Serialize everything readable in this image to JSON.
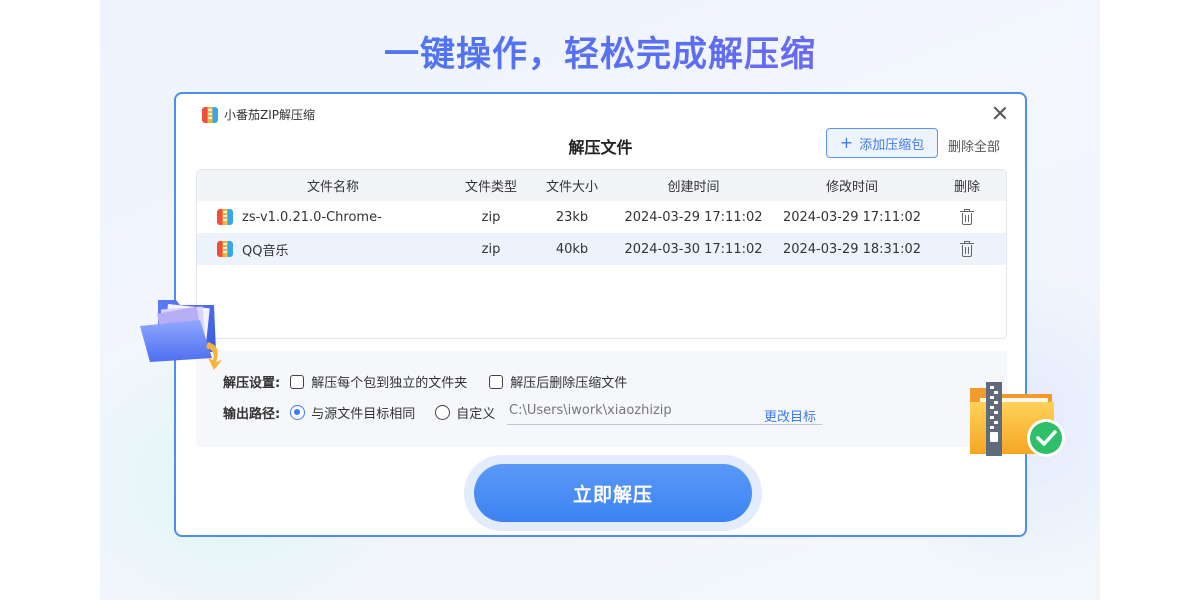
{
  "headline": "一键操作，轻松完成解压缩",
  "window": {
    "app_name": "小番茄ZIP解压缩",
    "panel_title": "解压文件",
    "add_button": "添加压缩包",
    "delete_all": "删除全部"
  },
  "table": {
    "headers": [
      "文件名称",
      "文件类型",
      "文件大小",
      "创建时间",
      "修改时间",
      "删除"
    ],
    "rows": [
      {
        "name": "zs-v1.0.21.0-Chrome-",
        "type": "zip",
        "size": "23kb",
        "created": "2024-03-29  17:11:02",
        "modified": "2024-03-29  17:11:02",
        "selected": false
      },
      {
        "name": "QQ音乐",
        "type": "zip",
        "size": "40kb",
        "created": "2024-03-30  17:11:02",
        "modified": "2024-03-29  18:31:02",
        "selected": true
      }
    ]
  },
  "settings": {
    "extract_label": "解压设置:",
    "option_each_folder": "解压每个包到独立的文件夹",
    "option_delete_after": "解压后删除压缩文件",
    "output_label": "输出路径:",
    "radio_same_source": "与源文件目标相同",
    "radio_custom": "自定义",
    "selected_output": "与源文件目标相同",
    "custom_path": "C:\\Users\\iwork\\xiaozhizip",
    "change_target": "更改目标"
  },
  "action_button": "立即解压",
  "colors": {
    "accent": "#3c82f2",
    "window_border": "#4d8ef3",
    "headline_start": "#3f7cf5",
    "headline_end": "#8b5cf0"
  },
  "icons": [
    "zip-app-icon",
    "close-icon",
    "plus-icon",
    "trash-icon",
    "folder-illustration",
    "zip-folder-check-illustration"
  ]
}
